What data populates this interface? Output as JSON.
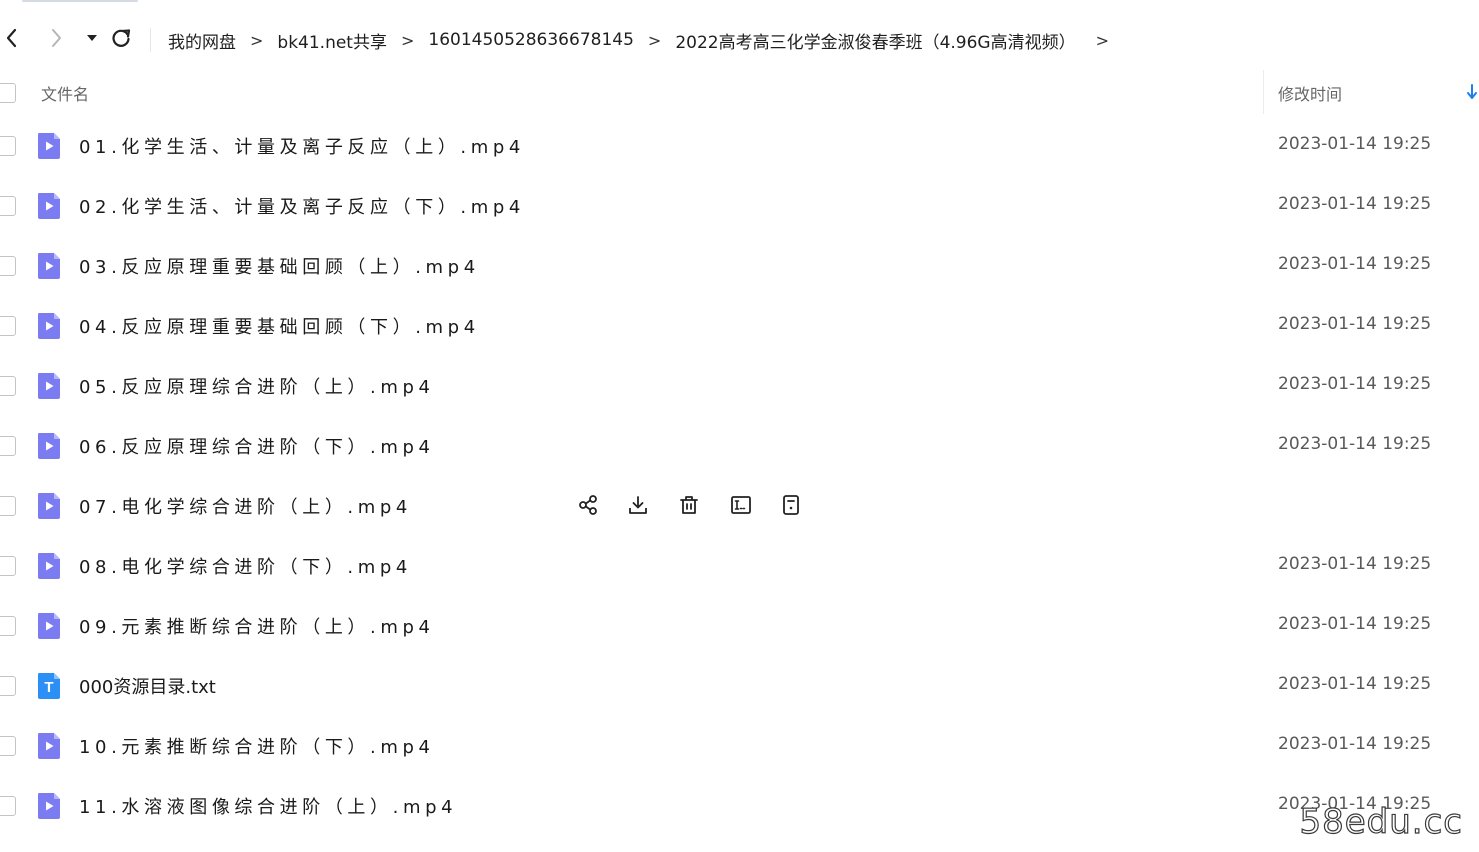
{
  "breadcrumb": {
    "items": [
      "我的网盘",
      "bk41.net共享",
      "1601450528636678145",
      "2022高考高三化学金淑俊春季班（4.96G高清视频）"
    ],
    "separator": ">"
  },
  "header": {
    "name_label": "文件名",
    "time_label": "修改时间",
    "sort_icon": "arrow-down-icon"
  },
  "files": [
    {
      "name": "01.化学生活、计量及离子反应（上）.mp4",
      "time": "2023-01-14 19:25",
      "type": "video"
    },
    {
      "name": "02.化学生活、计量及离子反应（下）.mp4",
      "time": "2023-01-14 19:25",
      "type": "video"
    },
    {
      "name": "03.反应原理重要基础回顾（上）.mp4",
      "time": "2023-01-14 19:25",
      "type": "video"
    },
    {
      "name": "04.反应原理重要基础回顾（下）.mp4",
      "time": "2023-01-14 19:25",
      "type": "video"
    },
    {
      "name": "05.反应原理综合进阶（上）.mp4",
      "time": "2023-01-14 19:25",
      "type": "video"
    },
    {
      "name": "06.反应原理综合进阶（下）.mp4",
      "time": "2023-01-14 19:25",
      "type": "video"
    },
    {
      "name": "07.电化学综合进阶（上）.mp4",
      "time": "",
      "type": "video",
      "hovered": true
    },
    {
      "name": "08.电化学综合进阶（下）.mp4",
      "time": "2023-01-14 19:25",
      "type": "video"
    },
    {
      "name": "09.元素推断综合进阶（上）.mp4",
      "time": "2023-01-14 19:25",
      "type": "video"
    },
    {
      "name": "000资源目录.txt",
      "time": "2023-01-14 19:25",
      "type": "text",
      "icon_letter": "T"
    },
    {
      "name": "10.元素推断综合进阶（下）.mp4",
      "time": "2023-01-14 19:25",
      "type": "video"
    },
    {
      "name": "11.水溶液图像综合进阶（上）.mp4",
      "time": "2023-01-14 19:25",
      "type": "video"
    }
  ],
  "row_actions": [
    "share-icon",
    "download-icon",
    "delete-icon",
    "rename-icon",
    "more-icon"
  ],
  "colors": {
    "video_icon": "#7b7bf2",
    "text_icon": "#2b8ff5",
    "sort_arrow": "#1e7ef0"
  },
  "watermark": "58edu.cc"
}
